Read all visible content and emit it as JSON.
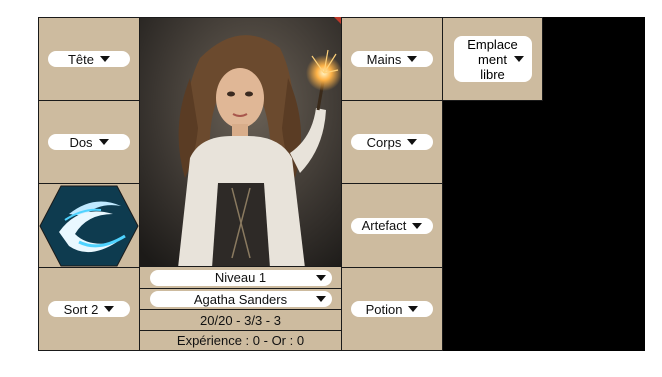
{
  "slots": {
    "tete": "Tête",
    "dos": "Dos",
    "sort2": "Sort 2",
    "mains": "Mains",
    "corps": "Corps",
    "artefact": "Artefact",
    "potion": "Potion",
    "emplacement": "Emplace\nment\nlibre"
  },
  "character": {
    "niveau": "Niveau 1",
    "name": "Agatha Sanders",
    "stats": "20/20 - 3/3 - 3",
    "xp_gold": "Expérience : 0 - Or : 0"
  },
  "colors": {
    "panel": "#cdbb9f",
    "black": "#000000",
    "accent_red": "#c0392b"
  },
  "icons": {
    "spell": "wind-swirl-hexagon-icon",
    "dropdown": "chevron-down-icon"
  }
}
